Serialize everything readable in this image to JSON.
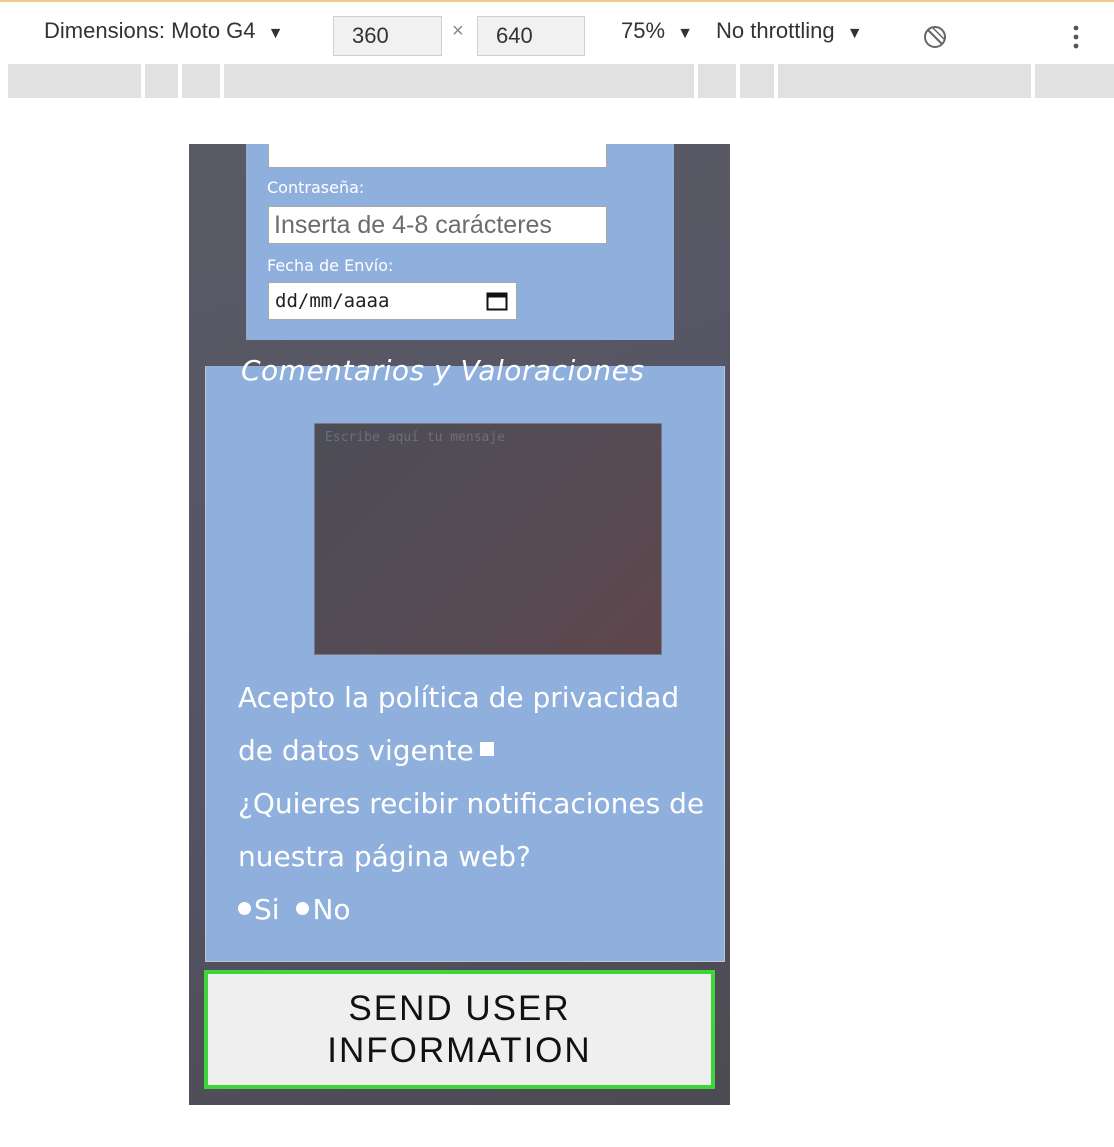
{
  "devtools": {
    "device_label": "Dimensions: Moto G4",
    "width": "360",
    "times": "×",
    "height": "640",
    "zoom": "75%",
    "throttling": "No throttling",
    "dropdown_glyph": "▼"
  },
  "form": {
    "password_label": "Contraseña:",
    "password_placeholder": "Inserta de 4-8 carácteres",
    "date_label": "Fecha de Envío:",
    "date_value": "dd/mm/aaaa"
  },
  "comments": {
    "title": "Comentarios y Valoraciones",
    "message_placeholder": "Escribe aquí tu mensaje",
    "privacy_text": "Acepto la política de privacidad de datos vigente",
    "notifications_text": "¿Quieres recibir notificaciones de nuestra página web?",
    "radio_yes": "Si",
    "radio_no": "No"
  },
  "submit": {
    "label_line1": "SEND USER",
    "label_line2": "INFORMATION"
  },
  "colors": {
    "panel": "#8fb0dc",
    "device_bg": "#555563",
    "button_border": "#3ed43a"
  }
}
